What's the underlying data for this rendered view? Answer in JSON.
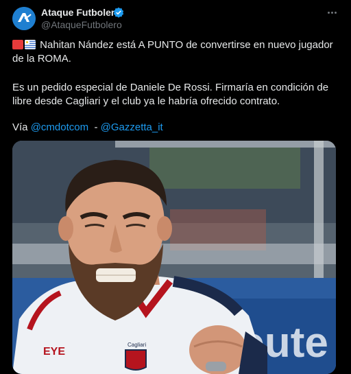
{
  "tweet": {
    "author": {
      "name": "Ataque Futbolero",
      "handle": "@AtaqueFutbolero",
      "verified": true,
      "avatar_icon": "avatar-logo-icon"
    },
    "more_icon": "more-options-icon",
    "text": {
      "line1": "Nahitan Nández está A PUNTO de convertirse en nuevo jugador de la ROMA.",
      "line2": "Es un pedido especial de Daniele De Rossi. Firmaría en condición de libre desde Cagliari y el club ya le habría ofrecido contrato.",
      "via_prefix": "Vía ",
      "via_link1": "@cmdotcom",
      "via_sep": "  - ",
      "via_link2": "@Gazzetta_it",
      "flags": [
        "red-flag-icon",
        "uruguay-flag-icon"
      ]
    },
    "media": {
      "alt": "Photo of a bearded football player celebrating in a white Cagliari kit",
      "kit_text": "Cagliari",
      "sponsor_text": "oute",
      "colors": {
        "shirt": "#eef1f5",
        "trim": "#b5141e",
        "navy": "#1b2a4a"
      }
    },
    "link_color": "#1d9bf0"
  }
}
